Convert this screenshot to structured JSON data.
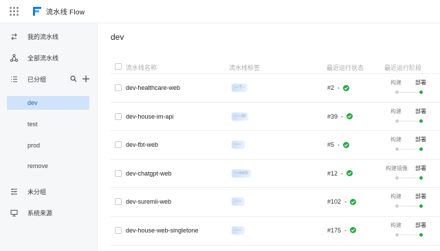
{
  "header": {
    "app_name": "流水线 Flow",
    "brand_color": "#1677ff"
  },
  "sidebar": {
    "my_pipelines": "我的流水线",
    "all_pipelines": "全部流水线",
    "grouped": "已分组",
    "groups": [
      "dev",
      "test",
      "prod",
      "remove"
    ],
    "active_group": "dev",
    "ungrouped": "未分组",
    "system_source": "系统来源"
  },
  "main": {
    "title": "dev",
    "columns": {
      "name": "流水线名称",
      "tag": "流水线标签",
      "status": "最近运行状态",
      "stage": "最近运行阶段"
    },
    "rows": [
      {
        "name": "dev-healthcare-web",
        "tag": "⎯⎯T⎯",
        "run": "#2",
        "sep": "-",
        "stage_a": "构建",
        "stage_b": "部署"
      },
      {
        "name": "dev-house-im-api",
        "tag": "⎯⎯⎯M",
        "run": "#39",
        "sep": "-",
        "stage_a": "构建",
        "stage_b": "部署"
      },
      {
        "name": "dev-fbt-web",
        "tag": "⎯⎯⎯",
        "run": "#5",
        "sep": "-",
        "stage_a": "构建",
        "stage_b": "部署"
      },
      {
        "name": "dev-chatgpt-web",
        "tag": "⎯⎯web",
        "run": "#12",
        "sep": "-",
        "stage_a": "构建镜像",
        "stage_b": "部署"
      },
      {
        "name": "dev-suremii-web",
        "tag": "⎯⎯⎯",
        "run": "#102",
        "sep": "-",
        "stage_a": "构建",
        "stage_b": "部署"
      },
      {
        "name": "dev-house-web-singletone",
        "tag": "⎯⎯⎯",
        "run": "#175",
        "sep": "-",
        "stage_a": "构建",
        "stage_b": "部署"
      }
    ],
    "success_color": "#27a843"
  }
}
